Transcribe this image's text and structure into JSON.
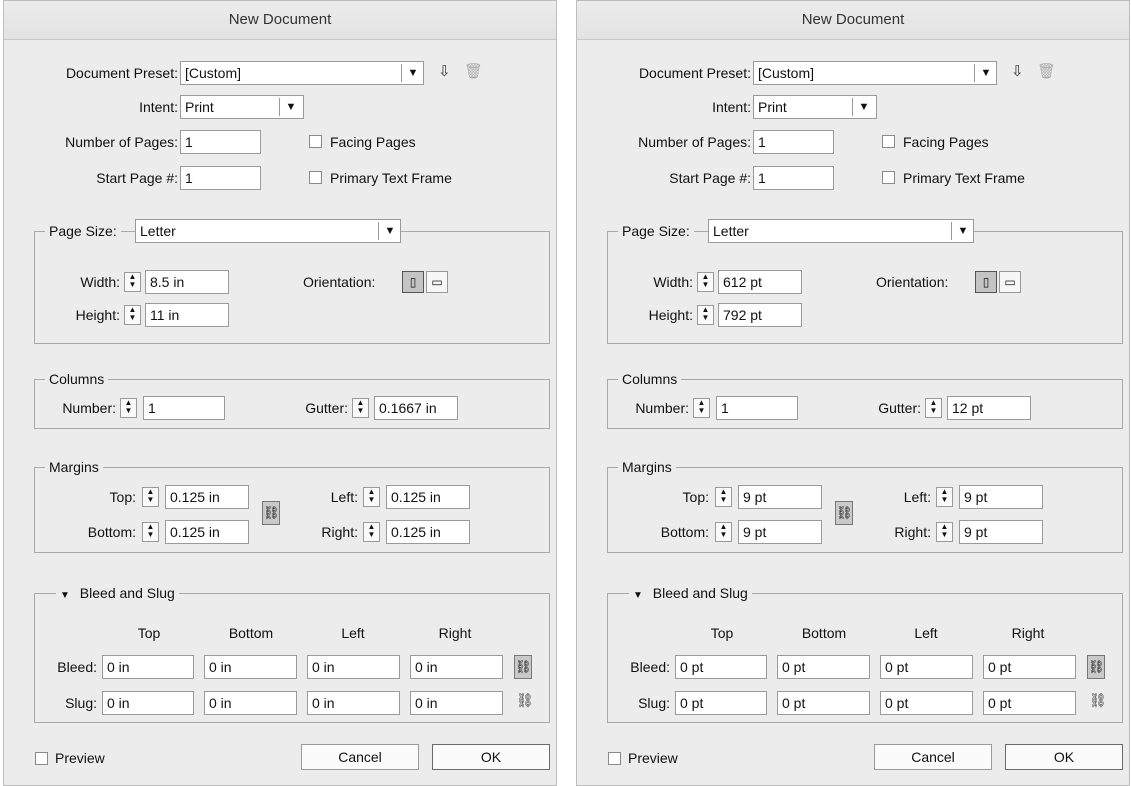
{
  "dialogs": [
    {
      "title": "New Document",
      "preset_label": "Document Preset:",
      "preset_value": "[Custom]",
      "intent_label": "Intent:",
      "intent_value": "Print",
      "pages_label": "Number of Pages:",
      "pages_value": "1",
      "start_label": "Start Page #:",
      "start_value": "1",
      "facing_label": "Facing Pages",
      "primary_label": "Primary Text Frame",
      "page_size_label": "Page Size:",
      "page_size_value": "Letter",
      "width_label": "Width:",
      "width_value": "8.5 in",
      "height_label": "Height:",
      "height_value": "11 in",
      "orientation_label": "Orientation:",
      "columns_title": "Columns",
      "number_label": "Number:",
      "number_value": "1",
      "gutter_label": "Gutter:",
      "gutter_value": "0.1667 in",
      "margins_title": "Margins",
      "top_label": "Top:",
      "top_value": "0.125 in",
      "bottom_label": "Bottom:",
      "bottom_value": "0.125 in",
      "left_label": "Left:",
      "left_value": "0.125 in",
      "right_label": "Right:",
      "right_value": "0.125 in",
      "bleed_title": "Bleed and Slug",
      "col_top": "Top",
      "col_bottom": "Bottom",
      "col_left": "Left",
      "col_right": "Right",
      "bleed_label": "Bleed:",
      "slug_label": "Slug:",
      "bleed_values": [
        "0 in",
        "0 in",
        "0 in",
        "0 in"
      ],
      "slug_values": [
        "0 in",
        "0 in",
        "0 in",
        "0 in"
      ],
      "preview_label": "Preview",
      "cancel_label": "Cancel",
      "ok_label": "OK"
    },
    {
      "title": "New Document",
      "preset_label": "Document Preset:",
      "preset_value": "[Custom]",
      "intent_label": "Intent:",
      "intent_value": "Print",
      "pages_label": "Number of Pages:",
      "pages_value": "1",
      "start_label": "Start Page #:",
      "start_value": "1",
      "facing_label": "Facing Pages",
      "primary_label": "Primary Text Frame",
      "page_size_label": "Page Size:",
      "page_size_value": "Letter",
      "width_label": "Width:",
      "width_value": "612 pt",
      "height_label": "Height:",
      "height_value": "792 pt",
      "orientation_label": "Orientation:",
      "columns_title": "Columns",
      "number_label": "Number:",
      "number_value": "1",
      "gutter_label": "Gutter:",
      "gutter_value": "12 pt",
      "margins_title": "Margins",
      "top_label": "Top:",
      "top_value": "9 pt",
      "bottom_label": "Bottom:",
      "bottom_value": "9 pt",
      "left_label": "Left:",
      "left_value": "9 pt",
      "right_label": "Right:",
      "right_value": "9 pt",
      "bleed_title": "Bleed and Slug",
      "col_top": "Top",
      "col_bottom": "Bottom",
      "col_left": "Left",
      "col_right": "Right",
      "bleed_label": "Bleed:",
      "slug_label": "Slug:",
      "bleed_values": [
        "0 pt",
        "0 pt",
        "0 pt",
        "0 pt"
      ],
      "slug_values": [
        "0 pt",
        "0 pt",
        "0 pt",
        "0 pt"
      ],
      "preview_label": "Preview",
      "cancel_label": "Cancel",
      "ok_label": "OK"
    }
  ],
  "icons": {
    "save_preset": "download-icon",
    "delete_preset": "trash-icon",
    "portrait": "portrait-orientation-icon",
    "landscape": "landscape-orientation-icon",
    "chain": "chain-link-icon",
    "chain_broken": "broken-chain-icon",
    "disclosure": "disclosure-triangle-icon"
  },
  "orientation_selected": "portrait",
  "checkboxes": {
    "facing_pages": false,
    "primary_text_frame": false,
    "preview": false
  }
}
